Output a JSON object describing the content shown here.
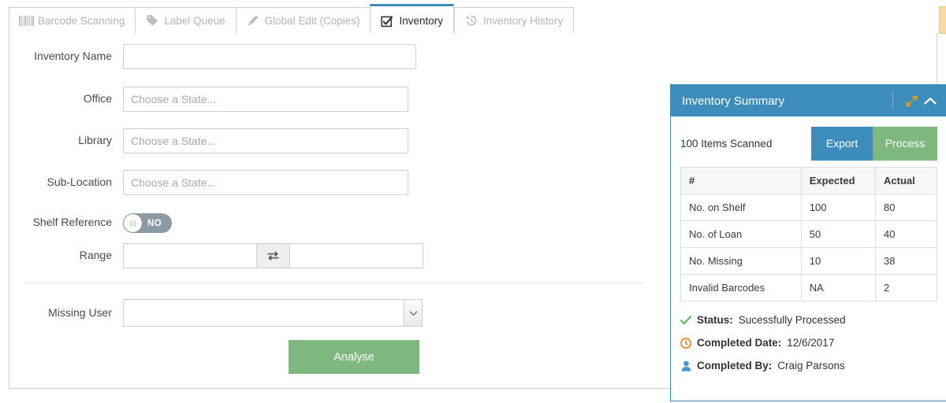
{
  "tabs": [
    {
      "label": "Barcode Scanning",
      "icon": "barcode-icon",
      "active": false
    },
    {
      "label": "Label Queue",
      "icon": "tag-icon",
      "active": false
    },
    {
      "label": "Global Edit (Copies)",
      "icon": "pencil-icon",
      "active": false
    },
    {
      "label": "Inventory",
      "icon": "checkbox-checked-icon",
      "active": true
    },
    {
      "label": "Inventory History",
      "icon": "history-icon",
      "active": false
    }
  ],
  "form": {
    "inventory_name": {
      "label": "Inventory Name",
      "value": "",
      "placeholder": ""
    },
    "office": {
      "label": "Office",
      "value": "",
      "placeholder": "Choose a State..."
    },
    "library": {
      "label": "Library",
      "value": "",
      "placeholder": "Choose a State..."
    },
    "sub_location": {
      "label": "Sub-Location",
      "value": "",
      "placeholder": "Choose a State..."
    },
    "shelf_reference": {
      "label": "Shelf Reference",
      "toggle_value": "NO"
    },
    "range": {
      "label": "Range",
      "from_value": "",
      "from_placeholder": "",
      "to_value": "",
      "to_placeholder": "",
      "swap_icon": "exchange-icon"
    },
    "missing_user": {
      "label": "Missing User",
      "selected": "",
      "options": [
        ""
      ]
    },
    "analyse_button": "Analyse"
  },
  "summary": {
    "title": "Inventory Summary",
    "expand_icon": "expand-arrows-icon",
    "collapse_icon": "chevron-up-icon",
    "scanned_text": "100 Items Scanned",
    "export_button": "Export",
    "process_button": "Process",
    "table": {
      "headers": [
        "#",
        "Expected",
        "Actual"
      ],
      "rows": [
        [
          "No. on Shelf",
          "100",
          "80"
        ],
        [
          "No. of Loan",
          "50",
          "40"
        ],
        [
          "No. Missing",
          "10",
          "38"
        ],
        [
          "Invalid Barcodes",
          "NA",
          "2"
        ]
      ]
    },
    "status": {
      "status_label": "Status:",
      "status_value": "Sucessfully Processed",
      "status_icon": "check-icon",
      "date_label": "Completed Date:",
      "date_value": "12/6/2017",
      "date_icon": "clock-icon",
      "by_label": "Completed By:",
      "by_value": "Craig Parsons",
      "by_icon": "user-icon"
    }
  },
  "colors": {
    "accent_blue": "#3c8dbc",
    "accent_green": "#7eb87e",
    "orange": "#f39c12",
    "toggle_off": "#8a9ba5"
  }
}
